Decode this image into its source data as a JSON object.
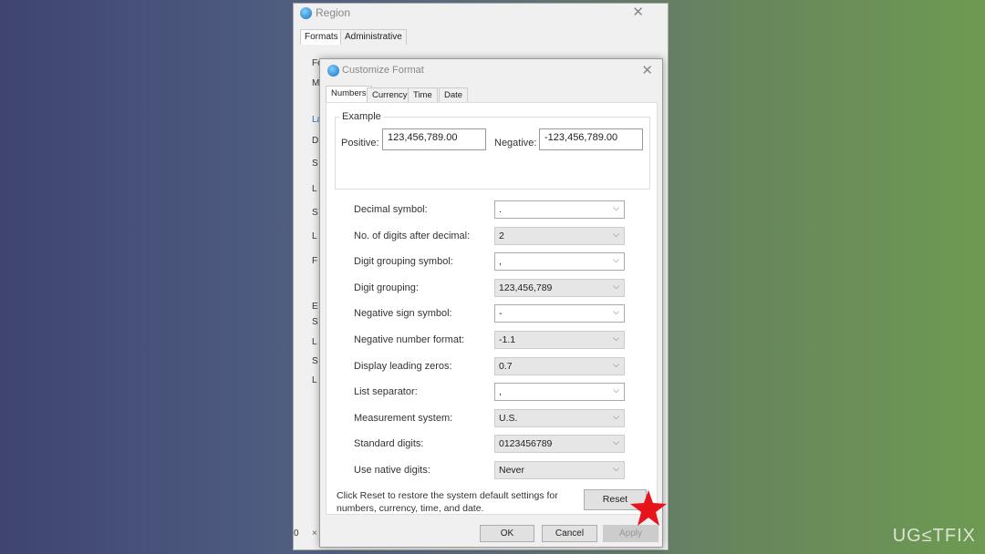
{
  "region_window": {
    "title": "Region",
    "tabs": [
      "Formats",
      "Administrative"
    ],
    "partial_letters": [
      "Fo",
      "M",
      "La",
      "D",
      "S",
      "L",
      "S",
      "L",
      "F",
      "E",
      "S",
      "L",
      "S",
      "L"
    ],
    "bottom_fragment": "0",
    "bottom_close": "×"
  },
  "customize_format": {
    "title": "Customize Format",
    "tabs": [
      "Numbers",
      "Currency",
      "Time",
      "Date"
    ],
    "active_tab": "Numbers",
    "example": {
      "legend": "Example",
      "positive_label": "Positive:",
      "positive_value": "123,456,789.00",
      "negative_label": "Negative:",
      "negative_value": "-123,456,789.00"
    },
    "settings": [
      {
        "label": "Decimal symbol:",
        "value": ".",
        "editable": true
      },
      {
        "label": "No. of digits after decimal:",
        "value": "2",
        "editable": false
      },
      {
        "label": "Digit grouping symbol:",
        "value": ",",
        "editable": true
      },
      {
        "label": "Digit grouping:",
        "value": "123,456,789",
        "editable": false
      },
      {
        "label": "Negative sign symbol:",
        "value": "-",
        "editable": true
      },
      {
        "label": "Negative number format:",
        "value": "-1.1",
        "editable": false
      },
      {
        "label": "Display leading zeros:",
        "value": "0.7",
        "editable": false
      },
      {
        "label": "List separator:",
        "value": ",",
        "editable": true
      },
      {
        "label": "Measurement system:",
        "value": "U.S.",
        "editable": false
      },
      {
        "label": "Standard digits:",
        "value": "0123456789",
        "editable": false
      },
      {
        "label": "Use native digits:",
        "value": "Never",
        "editable": false
      }
    ],
    "reset_note": "Click Reset to restore the system default settings for numbers, currency, time, and date.",
    "reset_label": "Reset",
    "ok_label": "OK",
    "cancel_label": "Cancel",
    "apply_label": "Apply"
  },
  "annotation": {
    "star_color": "#e8141c"
  },
  "watermark": "UG≤TFIX"
}
